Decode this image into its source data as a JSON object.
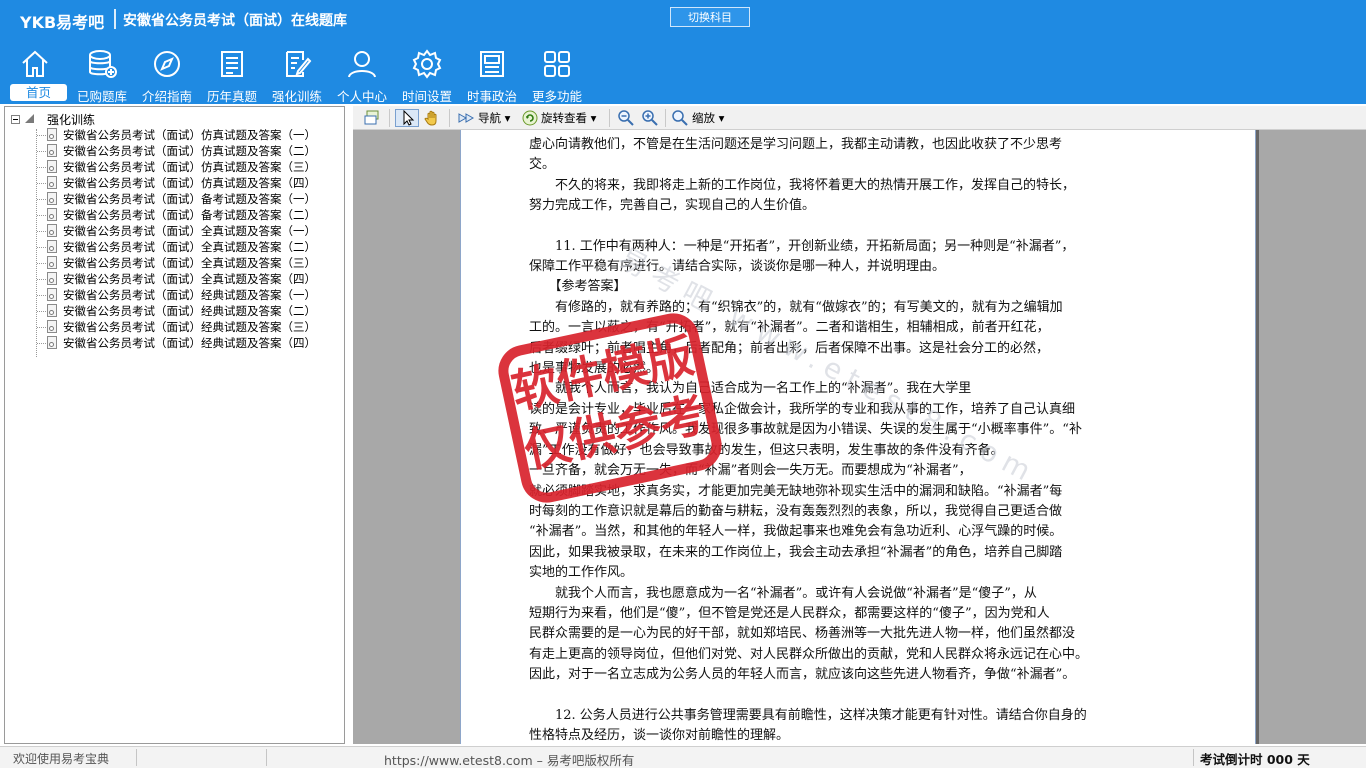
{
  "header": {
    "brand": "YKB易考吧",
    "title": "安徽省公务员考试（面试）在线题库",
    "switch_button": "切换科目",
    "nav": [
      {
        "label": "首页",
        "icon": "home-icon",
        "active": true
      },
      {
        "label": "已购题库",
        "icon": "database-add-icon"
      },
      {
        "label": "介绍指南",
        "icon": "compass-icon"
      },
      {
        "label": "历年真题",
        "icon": "document-list-icon"
      },
      {
        "label": "强化训练",
        "icon": "edit-document-icon"
      },
      {
        "label": "个人中心",
        "icon": "user-icon"
      },
      {
        "label": "时间设置",
        "icon": "gear-icon"
      },
      {
        "label": "时事政治",
        "icon": "news-icon"
      },
      {
        "label": "更多功能",
        "icon": "grid-icon"
      }
    ]
  },
  "tree": {
    "root": "强化训练",
    "items": [
      "安徽省公务员考试（面试）仿真试题及答案（一）",
      "安徽省公务员考试（面试）仿真试题及答案（二）",
      "安徽省公务员考试（面试）仿真试题及答案（三）",
      "安徽省公务员考试（面试）仿真试题及答案（四）",
      "安徽省公务员考试（面试）备考试题及答案（一）",
      "安徽省公务员考试（面试）备考试题及答案（二）",
      "安徽省公务员考试（面试）全真试题及答案（一）",
      "安徽省公务员考试（面试）全真试题及答案（二）",
      "安徽省公务员考试（面试）全真试题及答案（三）",
      "安徽省公务员考试（面试）全真试题及答案（四）",
      "安徽省公务员考试（面试）经典试题及答案（一）",
      "安徽省公务员考试（面试）经典试题及答案（二）",
      "安徽省公务员考试（面试）经典试题及答案（三）",
      "安徽省公务员考试（面试）经典试题及答案（四）"
    ]
  },
  "toolbar": {
    "nav_label": "导航",
    "rotate_label": "旋转查看",
    "zoom_label": "缩放"
  },
  "document": {
    "paragraphs": [
      "虚心向请教他们，不管是在生活问题还是学习问题上，我都主动请教，也因此收获了不少思考",
      "交。",
      "　　不久的将来，我即将走上新的工作岗位，我将怀着更大的热情开展工作，发挥自己的特长，",
      "努力完成工作，完善自己，实现自己的人生价值。",
      "",
      "　　11. 工作中有两种人：一种是“开拓者”，开创新业绩，开拓新局面；另一种则是“补漏者”，",
      "保障工作平稳有序进行。请结合实际，谈谈你是哪一种人，并说明理由。",
      "　　【参考答案】",
      "　　有修路的，就有养路的；有“织锦衣”的，就有“做嫁衣”的；有写美文的，就有为之编辑加",
      "工的。一言以蔽之，有“开拓者”，就有“补漏者”。二者和谐相生，相辅相成，前者开红花，",
      "后者缀绿叶；前者唱主角，后者配角；前者出彩，后者保障不出事。这是社会分工的必然，",
      "也是事物发展的必然。",
      "　　就我个人而言，我认为自己适合成为一名工作上的“补漏者”。我在大学里",
      "读的是会计专业，毕业后在一家私企做会计，我所学的专业和我从事的工作，培养了自己认真细",
      "致、严谨负责的工作作风。我发现很多事故就是因为小错误、失误的发生属于“小概率事件”。“补",
      "漏”工作没有做好，也会导致事故的发生，但这只表明，发生事故的条件没有齐备。",
      "一旦齐备，就会万无一失，而“补漏”者则会一失万无。而要想成为“补漏者”，",
      "就必须脚踏实地，求真务实，才能更加完美无缺地弥补现实生活中的漏洞和缺陷。“补漏者”每",
      "时每刻的工作意识就是幕后的勤奋与耕耘，没有轰轰烈烈的表象，所以，我觉得自己更适合做",
      "“补漏者”。当然，和其他的年轻人一样，我做起事来也难免会有急功近利、心浮气躁的时候。",
      "因此，如果我被录取，在未来的工作岗位上，我会主动去承担“补漏者”的角色，培养自己脚踏",
      "实地的工作作风。",
      "　　就我个人而言，我也愿意成为一名“补漏者”。或许有人会说做“补漏者”是“傻子”，从",
      "短期行为来看，他们是“傻”，但不管是党还是人民群众，都需要这样的“傻子”，因为党和人",
      "民群众需要的是一心为民的好干部，就如郑培民、杨善洲等一大批先进人物一样，他们虽然都没",
      "有走上更高的领导岗位，但他们对党、对人民群众所做出的贡献，党和人民群众将永远记在心中。",
      "因此，对于一名立志成为公务人员的年轻人而言，就应该向这些先进人物看齐，争做“补漏者”。",
      "",
      "　　12. 公务人员进行公共事务管理需要具有前瞻性，这样决策才能更有针对性。请结合你自身的",
      "性格特点及经历，谈一谈你对前瞻性的理解。"
    ],
    "watermark_text": "易考吧 www.etest8.com",
    "stamp_line1": "软件模版",
    "stamp_line2": "仅供参考"
  },
  "status": {
    "welcome": "欢迎使用易考宝典",
    "copyright": "https://www.etest8.com – 易考吧版权所有",
    "countdown": "考试倒计时 000 天"
  },
  "colors": {
    "header_bg": "#1f8ae2",
    "stamp_red": "#d9232d"
  }
}
